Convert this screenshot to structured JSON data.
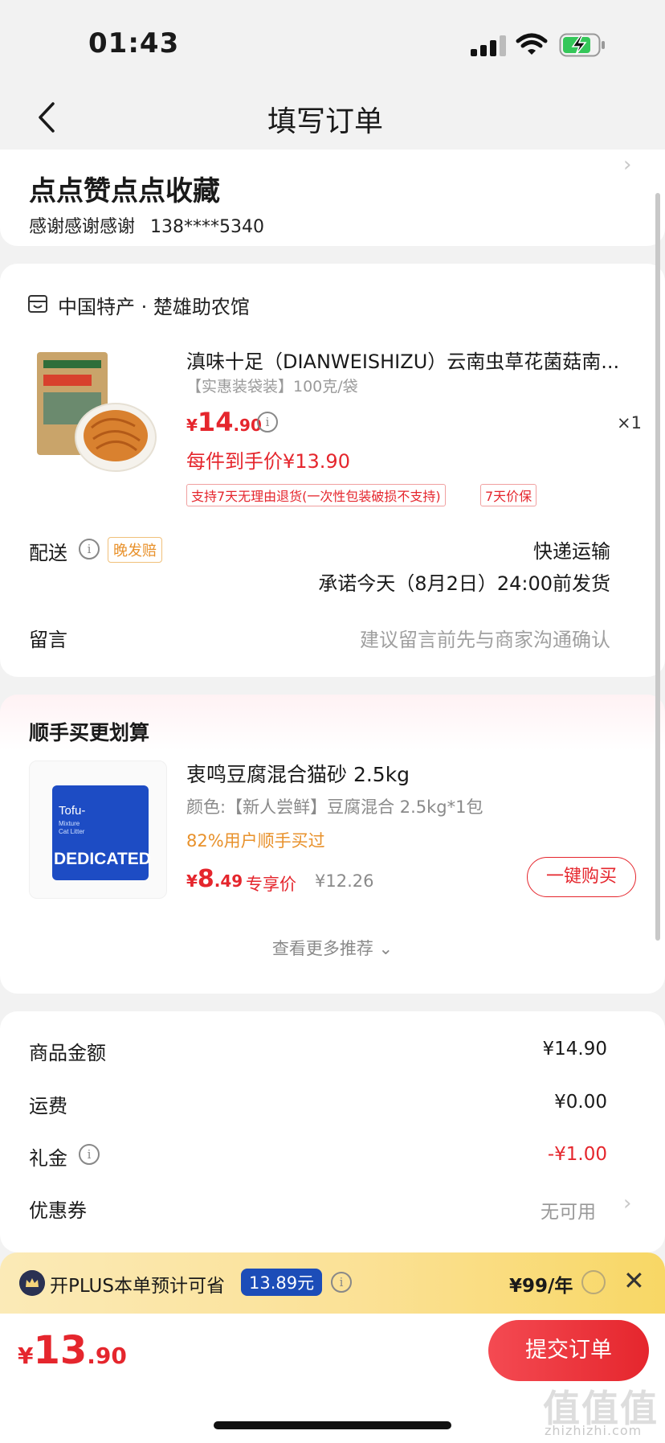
{
  "status_bar": {
    "time": "01:43"
  },
  "nav": {
    "title": "填写订单"
  },
  "address": {
    "name": "点点赞点点收藏",
    "contact": "感谢感谢感谢",
    "phone": "138****5340"
  },
  "order": {
    "shop_name": "中国特产 · 楚雄助农馆",
    "product": {
      "title": "滇味十足（DIANWEISHIZU）云南虫草花菌菇南...",
      "spec": "【实惠装袋装】100克/袋",
      "price_currency": "¥",
      "price_int": "14",
      "price_dec": ".90",
      "quantity": "×1",
      "final_price": "每件到手价¥13.90",
      "tags": [
        "支持7天无理由退货(一次性包装破损不支持)",
        "7天价保"
      ]
    },
    "delivery": {
      "label": "配送",
      "late_tag": "晚发赔",
      "method": "快递运输",
      "promise": "承诺今天（8月2日）24:00前发货"
    },
    "message": {
      "label": "留言",
      "placeholder": "建议留言前先与商家沟通确认"
    }
  },
  "recommend": {
    "title": "顺手买更划算",
    "product": {
      "name": "衷鸣豆腐混合猫砂 2.5kg",
      "spec": "颜色:【新人尝鲜】豆腐混合 2.5kg*1包",
      "bought_pct": "82%用户顺手买过",
      "price_currency": "¥",
      "price_int": "8",
      "price_dec": ".49",
      "exclusive_label": "专享价",
      "original_price": "¥12.26",
      "package_text": [
        "Tofu-",
        "Mixture",
        "Cat Litter",
        "DEDICATED"
      ]
    },
    "buy_button": "一键购买",
    "more": "查看更多推荐 ⌄"
  },
  "summary": {
    "rows": [
      {
        "label": "商品金额",
        "value": "¥14.90"
      },
      {
        "label": "运费",
        "value": "¥0.00"
      },
      {
        "label": "礼金",
        "value": "-¥1.00"
      },
      {
        "label": "优惠券",
        "value": "无可用"
      }
    ]
  },
  "plus_bar": {
    "text": "开PLUS本单预计可省",
    "save_amount": "13.89元",
    "price": "¥99/年"
  },
  "bottom_bar": {
    "total_currency": "¥",
    "total_int": "13",
    "total_dec": ".90",
    "submit_label": "提交订单"
  },
  "watermark": {
    "text": "值值值",
    "sub": "zhizhizhi.com"
  },
  "colors": {
    "accent_red": "#e5262d",
    "plus_blue": "#1c4db8",
    "orange": "#e8912b"
  }
}
